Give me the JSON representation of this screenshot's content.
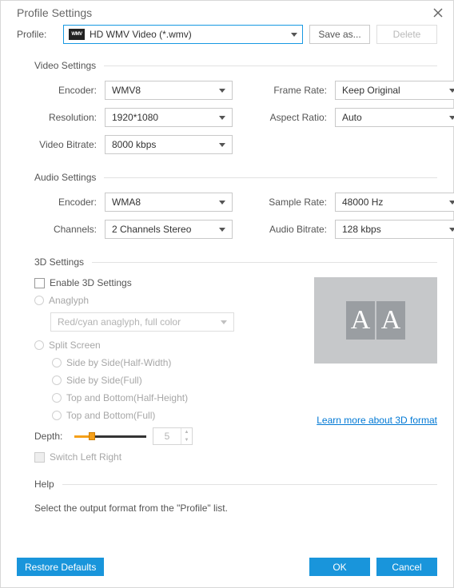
{
  "title": "Profile Settings",
  "profile": {
    "label": "Profile:",
    "value": "HD WMV Video (*.wmv)",
    "icon_text": "WMV",
    "save_as": "Save as...",
    "delete": "Delete"
  },
  "video": {
    "group": "Video Settings",
    "encoder_label": "Encoder:",
    "encoder": "WMV8",
    "resolution_label": "Resolution:",
    "resolution": "1920*1080",
    "bitrate_label": "Video Bitrate:",
    "bitrate": "8000 kbps",
    "frame_rate_label": "Frame Rate:",
    "frame_rate": "Keep Original",
    "aspect_label": "Aspect Ratio:",
    "aspect": "Auto"
  },
  "audio": {
    "group": "Audio Settings",
    "encoder_label": "Encoder:",
    "encoder": "WMA8",
    "channels_label": "Channels:",
    "channels": "2 Channels Stereo",
    "sample_label": "Sample Rate:",
    "sample": "48000 Hz",
    "bitrate_label": "Audio Bitrate:",
    "bitrate": "128 kbps"
  },
  "threed": {
    "group": "3D Settings",
    "enable": "Enable 3D Settings",
    "anaglyph": "Anaglyph",
    "anaglyph_mode": "Red/cyan anaglyph, full color",
    "split": "Split Screen",
    "opt_sbs_half": "Side by Side(Half-Width)",
    "opt_sbs_full": "Side by Side(Full)",
    "opt_tb_half": "Top and Bottom(Half-Height)",
    "opt_tb_full": "Top and Bottom(Full)",
    "depth_label": "Depth:",
    "depth_value": "5",
    "switch": "Switch Left Right",
    "learn_more": "Learn more about 3D format",
    "preview_letter": "A"
  },
  "help": {
    "group": "Help",
    "text": "Select the output format from the \"Profile\" list."
  },
  "footer": {
    "restore": "Restore Defaults",
    "ok": "OK",
    "cancel": "Cancel"
  }
}
